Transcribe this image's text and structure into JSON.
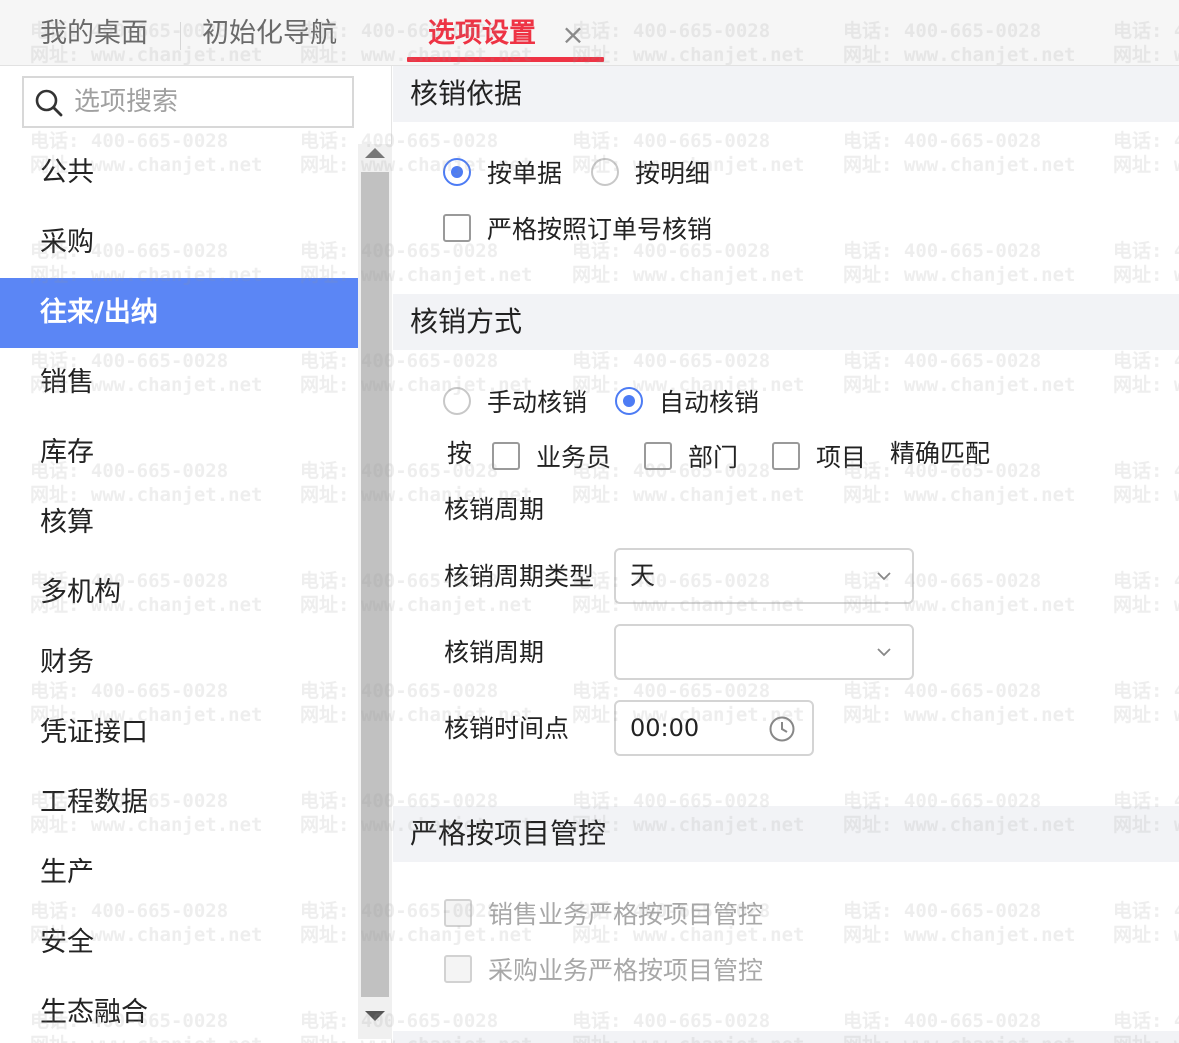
{
  "tabs": {
    "desktop": "我的桌面",
    "init_nav": "初始化导航",
    "options": "选项设置",
    "close_glyph": "×"
  },
  "search": {
    "placeholder": "选项搜索"
  },
  "sidebar": {
    "items": [
      {
        "label": "公共",
        "active": false
      },
      {
        "label": "采购",
        "active": false
      },
      {
        "label": "往来/出纳",
        "active": true
      },
      {
        "label": "销售",
        "active": false
      },
      {
        "label": "库存",
        "active": false
      },
      {
        "label": "核算",
        "active": false
      },
      {
        "label": "多机构",
        "active": false
      },
      {
        "label": "财务",
        "active": false
      },
      {
        "label": "凭证接口",
        "active": false
      },
      {
        "label": "工程数据",
        "active": false
      },
      {
        "label": "生产",
        "active": false
      },
      {
        "label": "安全",
        "active": false
      },
      {
        "label": "生态融合",
        "active": false
      }
    ]
  },
  "sections": {
    "basis": {
      "title": "核销依据",
      "by_document": "按单据",
      "by_detail": "按明细",
      "selected": "按单据",
      "strict_order": "严格按照订单号核销"
    },
    "method": {
      "title": "核销方式",
      "manual": "手动核销",
      "auto": "自动核销",
      "selected": "自动核销",
      "by_prefix": "按",
      "salesman": "业务员",
      "department": "部门",
      "project": "项目",
      "exact_match": "精确匹配",
      "cycle_heading": "核销周期",
      "cycle_type_label": "核销周期类型",
      "cycle_type_value": "天",
      "cycle_label": "核销周期",
      "cycle_value": "",
      "time_label": "核销时间点",
      "time_value": "00:00"
    },
    "project_control": {
      "title": "严格按项目管控",
      "sales": "销售业务严格按项目管控",
      "purchase": "采购业务严格按项目管控"
    }
  },
  "watermark": {
    "phone": "电话: 400-665-0028",
    "site": "网址: www.chanjet.net"
  },
  "colors": {
    "accent": "#4d7cf4",
    "active_menu_bg": "#5b86f5",
    "active_tab": "#ee3344",
    "section_bg": "#f2f3f6"
  }
}
